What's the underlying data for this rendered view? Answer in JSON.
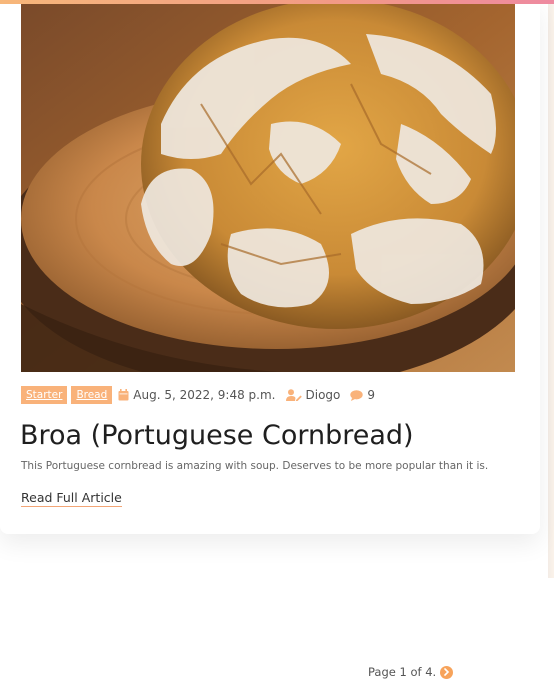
{
  "post": {
    "image_alt": "Round rustic loaf of Portuguese cornbread with a floury cracked crust on a wooden board",
    "tags": [
      "Starter",
      "Bread"
    ],
    "date": "Aug. 5, 2022, 9:48 p.m.",
    "author": "Diogo",
    "comment_count": "9",
    "title": "Broa (Portuguese Cornbread)",
    "excerpt": "This Portuguese cornbread is amazing with soup. Deserves to be more popular than it is.",
    "read_more": "Read Full Article"
  },
  "pagination": {
    "text": "Page 1 of 4."
  },
  "icons": {
    "date": "calendar-icon",
    "author": "user-edit-icon",
    "comments": "comment-icon",
    "next": "chevron-right-circle-icon"
  },
  "colors": {
    "accent": "#f9b27a",
    "accent_dark": "#f7a35b"
  }
}
